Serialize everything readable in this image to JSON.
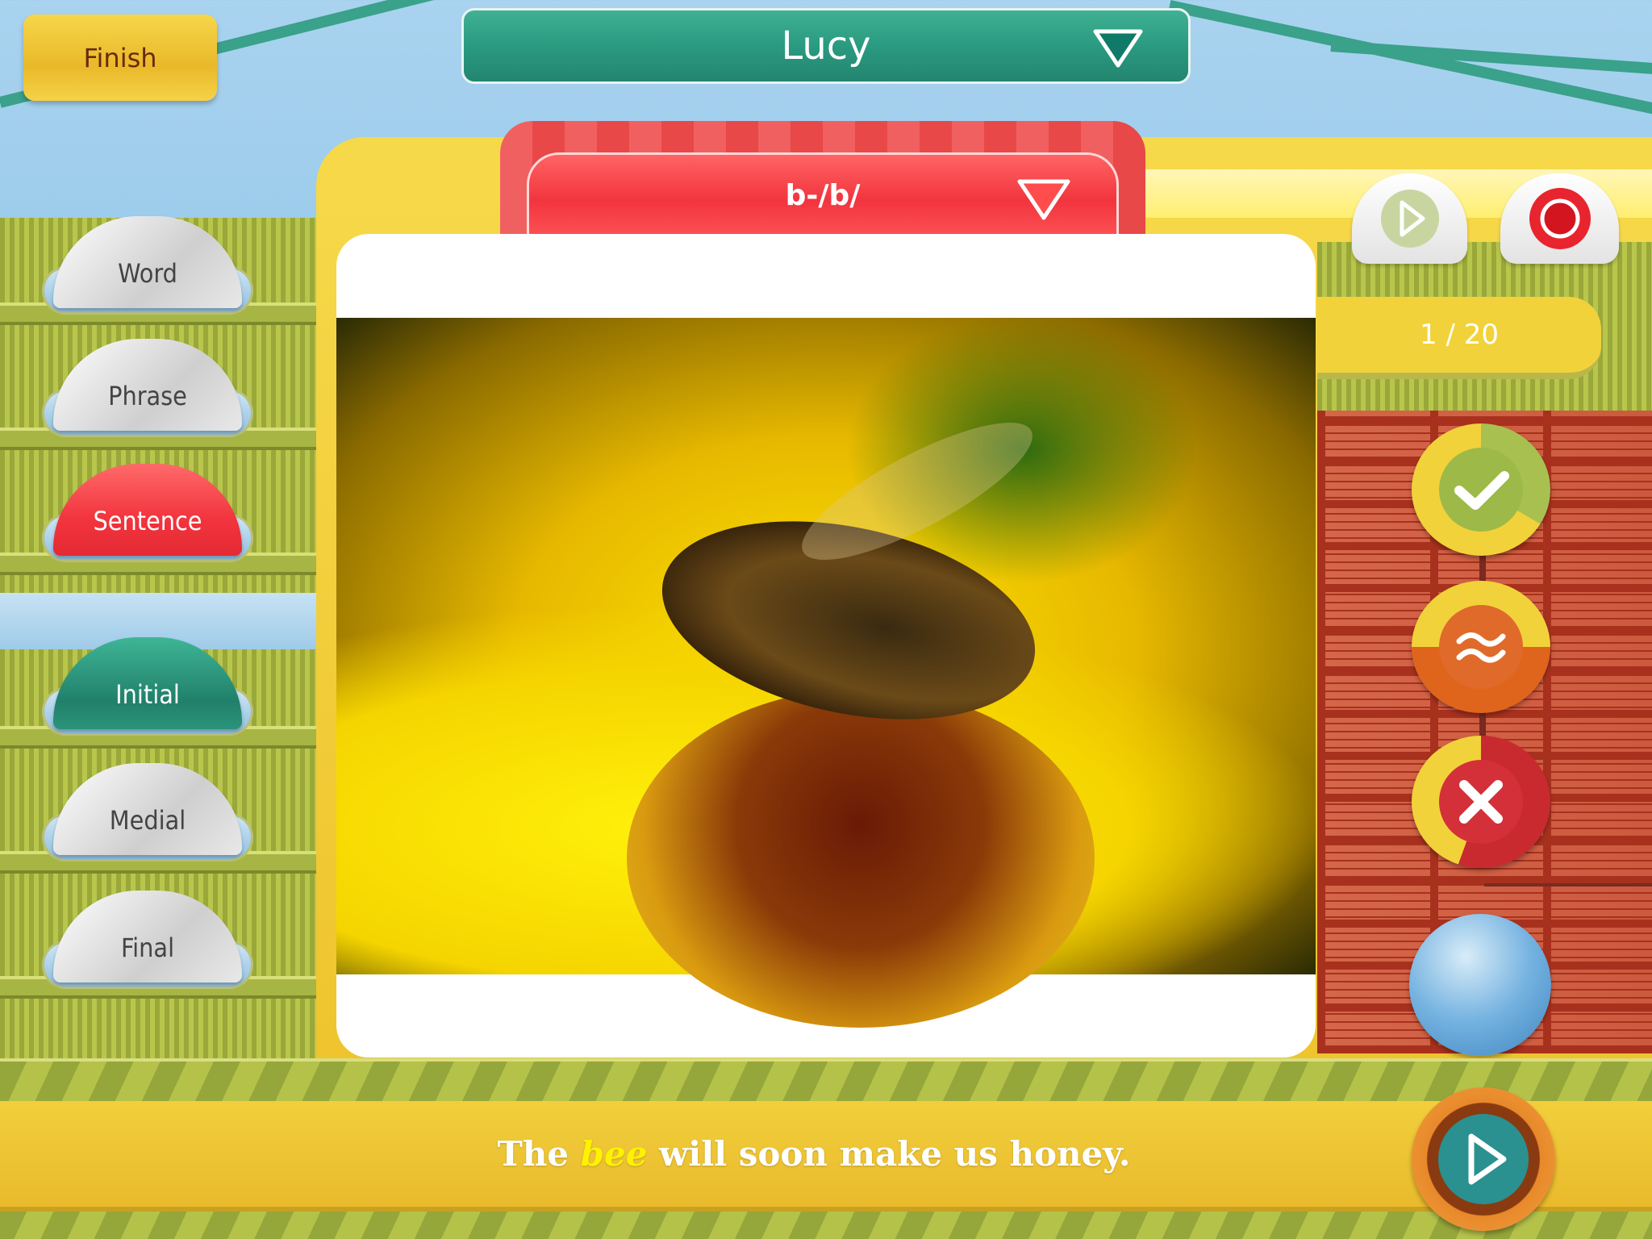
{
  "header": {
    "finish_label": "Finish",
    "student_name": "Lucy",
    "sound_selector": "b-/b/"
  },
  "levels": [
    {
      "label": "Word",
      "state": "normal"
    },
    {
      "label": "Phrase",
      "state": "normal"
    },
    {
      "label": "Sentence",
      "state": "selected"
    }
  ],
  "positions": [
    {
      "label": "Initial",
      "state": "selected"
    },
    {
      "label": "Medial",
      "state": "normal"
    },
    {
      "label": "Final",
      "state": "normal"
    }
  ],
  "progress": {
    "text": "1 / 20",
    "current": 1,
    "total": 20
  },
  "sentence": {
    "before": "The ",
    "target": "bee",
    "after": " will soon make us honey."
  },
  "scoring": {
    "correct_icon": "check-icon",
    "approximate_icon": "approx-icon",
    "incorrect_icon": "x-icon"
  },
  "colors": {
    "teal": "#2a9a80",
    "red": "#f2343e",
    "yellow": "#f0c531",
    "target_word": "#fff200"
  }
}
